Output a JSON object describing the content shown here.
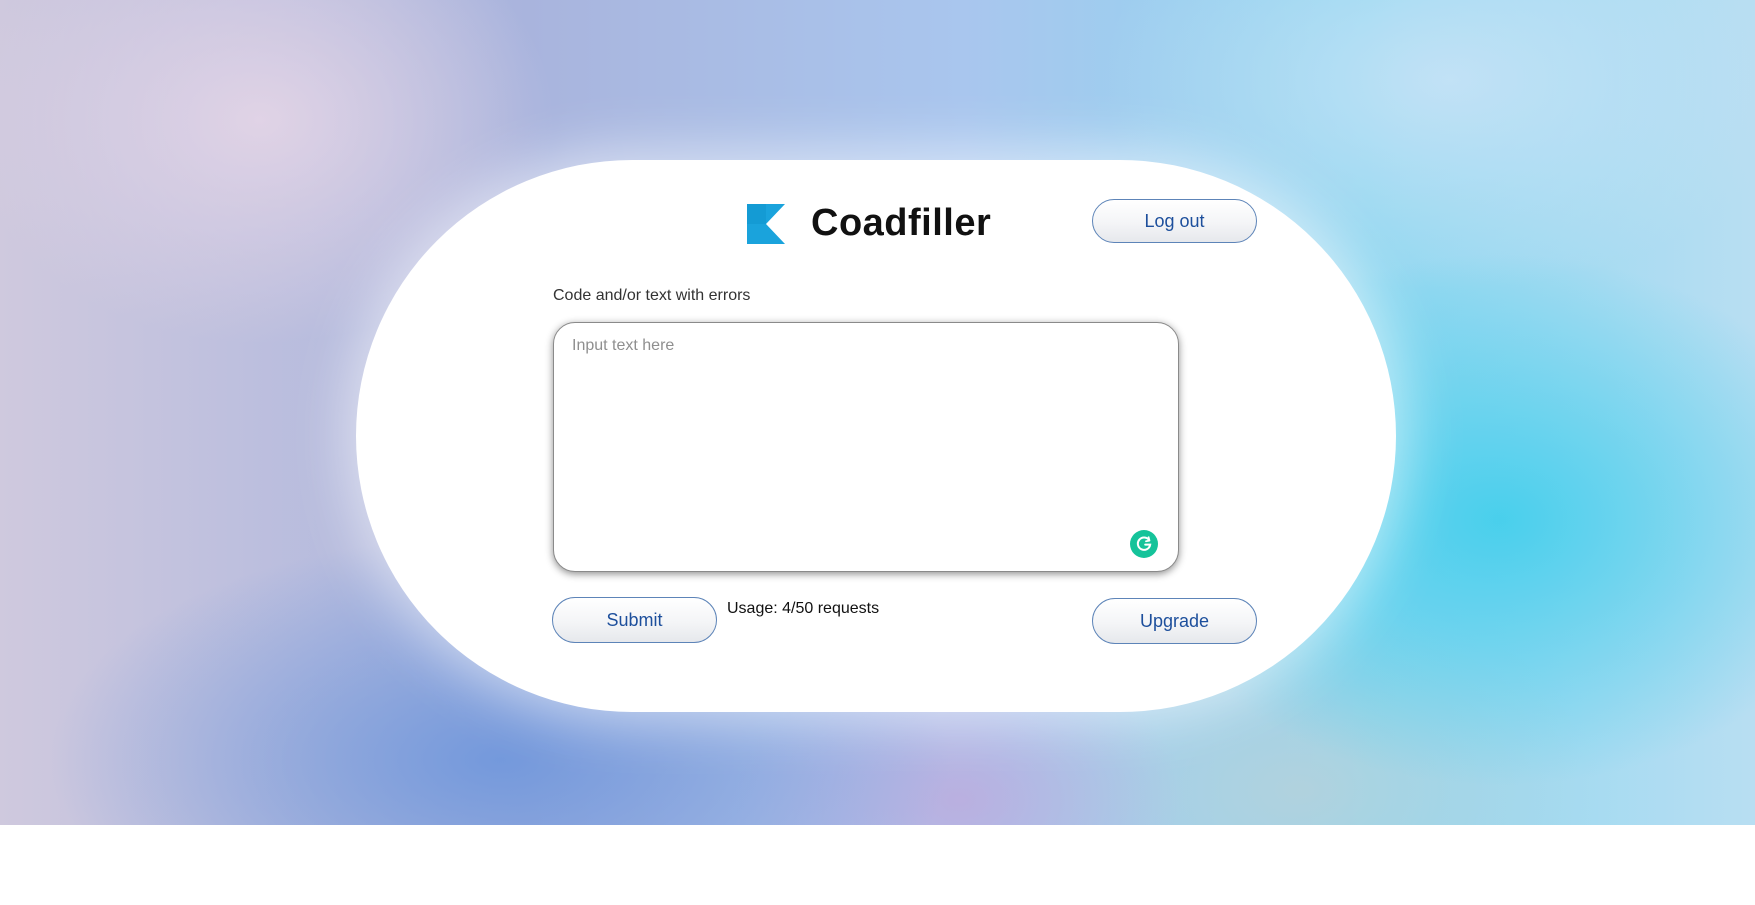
{
  "brand": {
    "name": "Coadfiller",
    "logo_icon": "coadfiller-logo-icon",
    "accent_color": "#1aa3dc"
  },
  "header": {
    "logout_label": "Log out"
  },
  "form": {
    "label": "Code and/or text with errors",
    "placeholder": "Input text here",
    "value": "",
    "assistant_icon": "grammarly-icon",
    "submit_label": "Submit",
    "usage_text": "Usage: 4/50 requests",
    "upgrade_label": "Upgrade"
  },
  "colors": {
    "button_text": "#1d4f9c",
    "button_border": "#5d84b8",
    "grammarly": "#15c39a"
  }
}
